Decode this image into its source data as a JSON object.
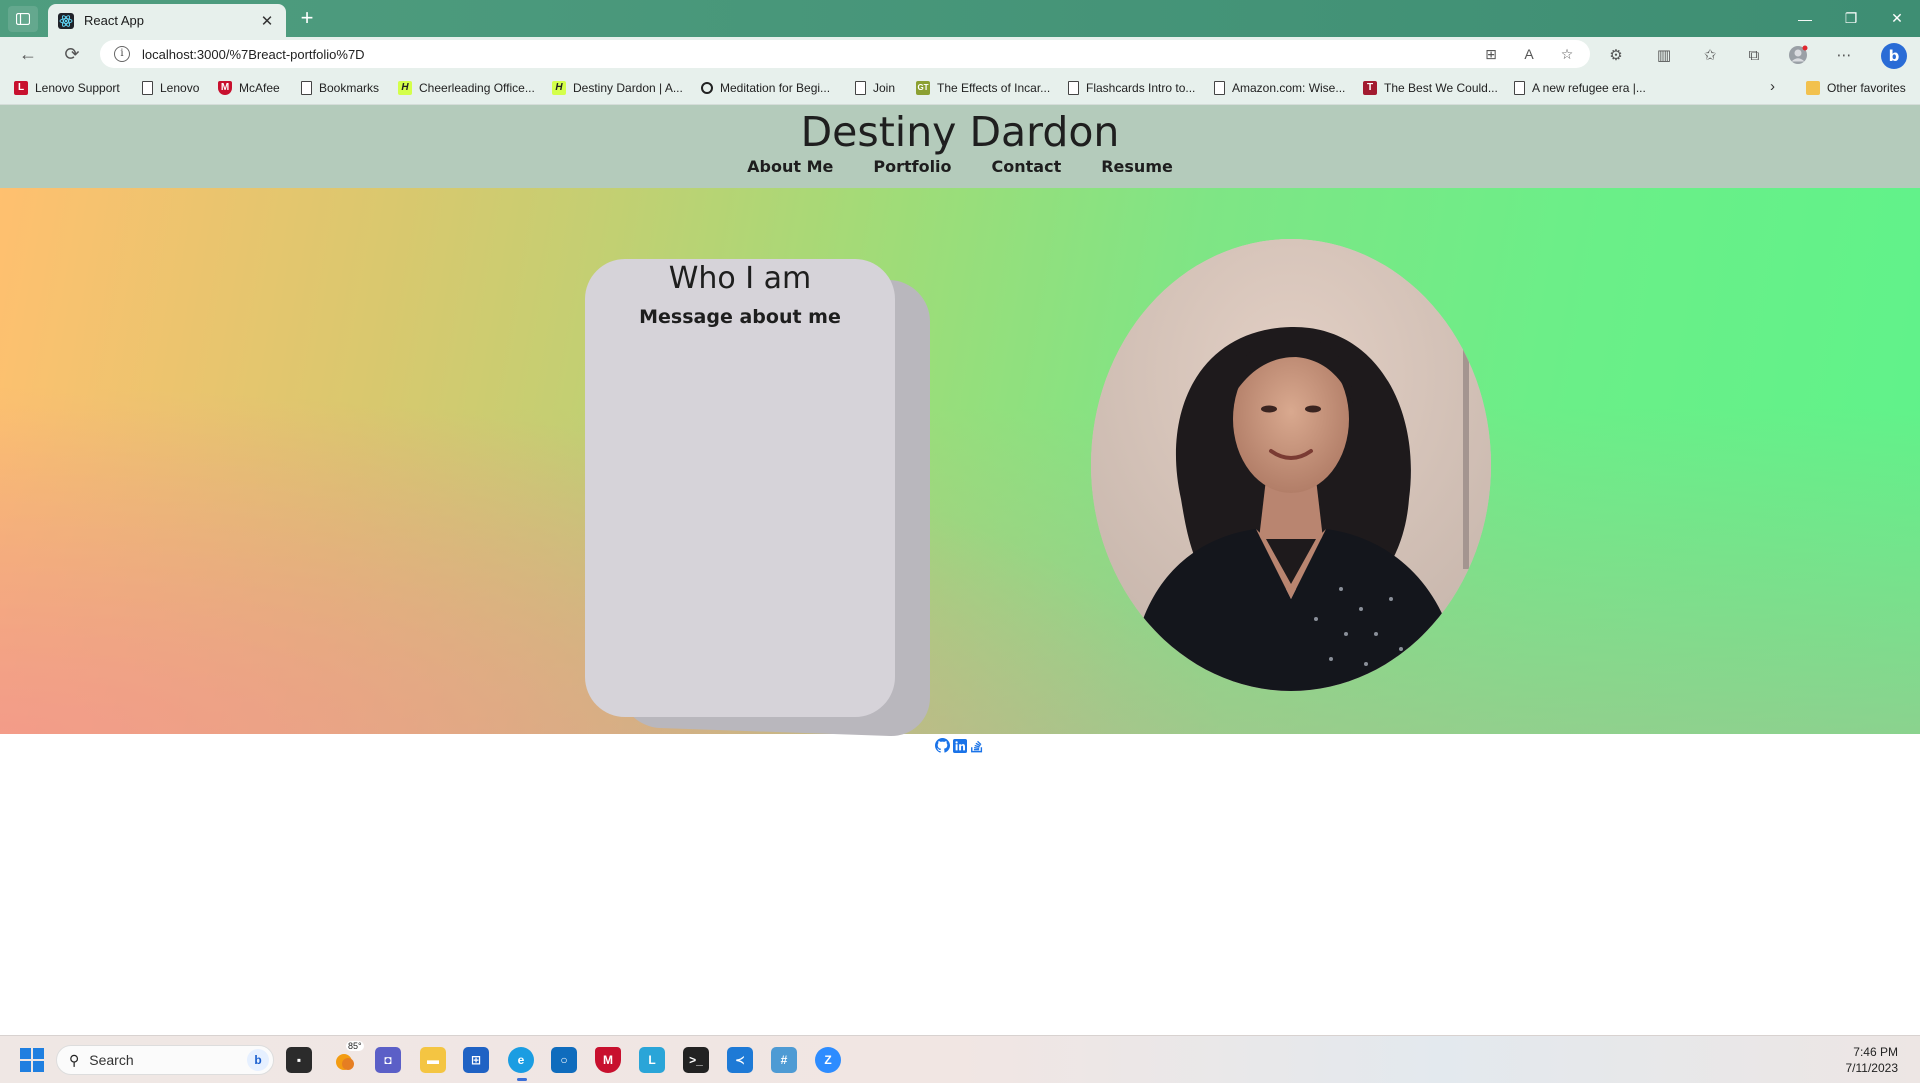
{
  "browser": {
    "tab_title": "React App",
    "tab_close": "✕",
    "new_tab": "+",
    "url": "localhost:3000/%7Breact-portfolio%7D",
    "window_controls": {
      "minimize": "—",
      "restore": "❐",
      "close": "✕"
    }
  },
  "bookmarks": {
    "items": [
      {
        "label": "Lenovo Support",
        "icon": "lenovo-red-icon"
      },
      {
        "label": "Lenovo",
        "icon": "page-icon"
      },
      {
        "label": "McAfee",
        "icon": "mcafee-shield-icon"
      },
      {
        "label": "Bookmarks",
        "icon": "page-icon"
      },
      {
        "label": "Cheerleading Office...",
        "icon": "lime-h-icon"
      },
      {
        "label": "Destiny Dardon | A...",
        "icon": "lime-h-icon"
      },
      {
        "label": "Meditation for Begi...",
        "icon": "ring-icon"
      },
      {
        "label": "Join",
        "icon": "page-icon"
      },
      {
        "label": "The Effects of Incar...",
        "icon": "gt-icon"
      },
      {
        "label": "Flashcards Intro to...",
        "icon": "page-icon"
      },
      {
        "label": "Amazon.com: Wise...",
        "icon": "page-icon"
      },
      {
        "label": "The Best We Could...",
        "icon": "darkred-icon"
      },
      {
        "label": "A new refugee era |...",
        "icon": "page-icon"
      }
    ],
    "other_favorites": "Other favorites"
  },
  "site": {
    "title": "Destiny Dardon",
    "nav": {
      "about": "About Me",
      "portfolio": "Portfolio",
      "contact": "Contact",
      "resume": "Resume"
    },
    "card": {
      "title": "Who I am",
      "subtitle": "Message about me"
    },
    "social": [
      "github-icon",
      "linkedin-icon",
      "stackoverflow-icon"
    ]
  },
  "taskbar": {
    "search_placeholder": "Search",
    "weather": "85°",
    "time": "7:46 PM",
    "date": "7/11/2023"
  }
}
